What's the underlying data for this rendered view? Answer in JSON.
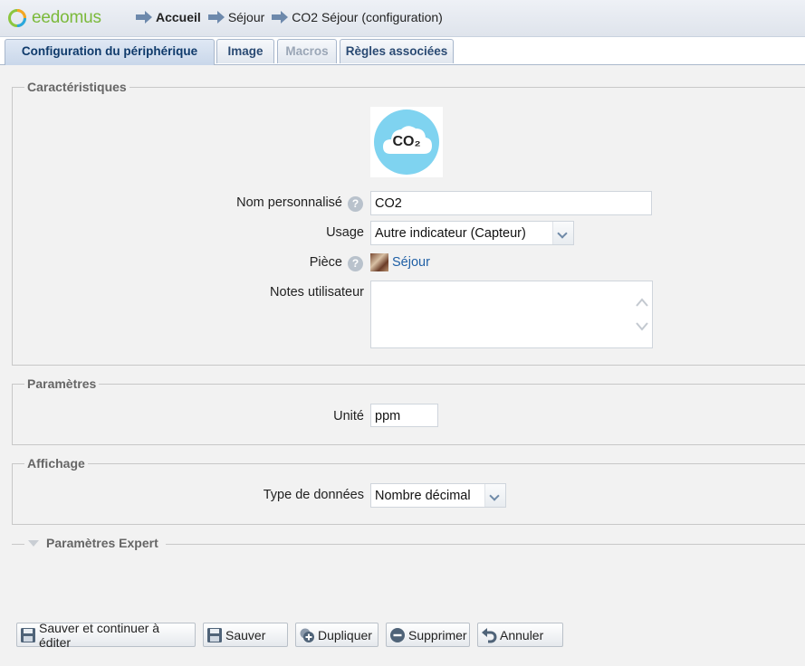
{
  "app": {
    "logo_text": "eedomus"
  },
  "breadcrumb": [
    {
      "label": "Accueil"
    },
    {
      "label": "Séjour"
    },
    {
      "label": "CO2 Séjour (configuration)"
    }
  ],
  "tabs": [
    {
      "label": "Configuration du périphérique",
      "state": "active"
    },
    {
      "label": "Image",
      "state": "normal"
    },
    {
      "label": "Macros",
      "state": "disabled"
    },
    {
      "label": "Règles associées",
      "state": "normal"
    }
  ],
  "caracteristiques": {
    "legend": "Caractéristiques",
    "device_icon_text": "CO₂",
    "name_label": "Nom personnalisé",
    "name_value": "CO2",
    "usage_label": "Usage",
    "usage_value": "Autre indicateur (Capteur)",
    "room_label": "Pièce",
    "room_value": "Séjour",
    "notes_label": "Notes utilisateur",
    "notes_value": ""
  },
  "parametres": {
    "legend": "Paramètres",
    "unit_label": "Unité",
    "unit_value": "ppm"
  },
  "affichage": {
    "legend": "Affichage",
    "data_type_label": "Type de données",
    "data_type_value": "Nombre décimal"
  },
  "expert": {
    "legend": "Paramètres Expert"
  },
  "buttons": {
    "save_continue": "Sauver et continuer à éditer",
    "save": "Sauver",
    "duplicate": "Dupliquer",
    "delete": "Supprimer",
    "cancel": "Annuler"
  },
  "colors": {
    "brand_green": "#7bb93a",
    "icon_blue": "#7fd3f0",
    "link_blue": "#1f5fa5"
  }
}
